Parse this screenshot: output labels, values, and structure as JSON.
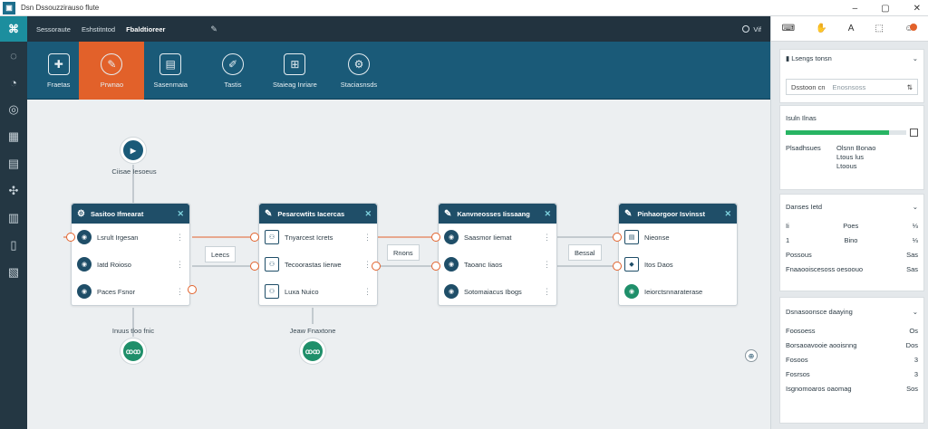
{
  "window": {
    "title": "Dsn Dssouzzirauso flute",
    "controls": [
      "–",
      "▢",
      "✕"
    ]
  },
  "rail": {
    "logo": "⌘",
    "icons": [
      "activity-icon",
      "timer-icon",
      "target-icon",
      "gallery-icon",
      "document-icon",
      "puzzle-icon",
      "building-icon",
      "book-icon",
      "notes-icon"
    ]
  },
  "topbar": {
    "nav": [
      "Sessoraute",
      "Eshstitntod",
      "Fbaldtioreer"
    ],
    "edit_icon": "✎",
    "user_label": "Vif"
  },
  "ribbon": {
    "items": [
      {
        "label": "Fraetas",
        "icon": "✚",
        "active": false
      },
      {
        "label": "Prwnao",
        "icon": "✎",
        "active": true
      },
      {
        "label": "Sasenmaia",
        "icon": "▤",
        "active": false
      },
      {
        "label": "Tastis",
        "icon": "✐",
        "active": false
      },
      {
        "label": "Staieag Inriare",
        "icon": "⊞",
        "active": false
      },
      {
        "label": "Staciasnsds",
        "icon": "⚙",
        "active": false
      }
    ]
  },
  "rp_top": {
    "icons": [
      "⌨",
      "✋",
      "A",
      "⬚",
      "☺"
    ]
  },
  "flow": {
    "start": {
      "caption": "Ciisae Iesoeus",
      "glyph": "▶"
    },
    "ends": [
      {
        "caption": "Inuus tloo fnic",
        "glyph": "ꝏꝏ"
      },
      {
        "caption": "Jeaw Fnaxtone",
        "glyph": "ꝏꝏ"
      }
    ],
    "cards": [
      {
        "title": "Sasitoo Ifmearat",
        "icon": "⚙",
        "rows": [
          {
            "label": "Lsrult Irgesan",
            "icon": "◉"
          },
          {
            "label": "Iatd Roioso",
            "icon": "◉"
          },
          {
            "label": "Paces Fsnor",
            "icon": "◉"
          }
        ]
      },
      {
        "title": "Pesarcwtits Iacercas",
        "icon": "✎",
        "rows": [
          {
            "label": "Tnyarcest Icrets",
            "icon": "⚇"
          },
          {
            "label": "Tecoorastas Iierwe",
            "icon": "⚇"
          },
          {
            "label": "Luxa Nuico",
            "icon": "⚇"
          }
        ]
      },
      {
        "title": "Kanvneosses Iissaang",
        "icon": "✎",
        "rows": [
          {
            "label": "Saasmor Iiemat",
            "icon": "◉"
          },
          {
            "label": "Taoanc Iiaos",
            "icon": "◉"
          },
          {
            "label": "Sotomaiacus Ibogs",
            "icon": "◉"
          }
        ]
      },
      {
        "title": "Pinhaorgoor Isvinsst",
        "icon": "✎",
        "rows": [
          {
            "label": "Nieonse",
            "icon": "▤"
          },
          {
            "label": "Itos Daos",
            "icon": "◆"
          },
          {
            "label": "Ieiorctsnnaraterase",
            "icon": "◉"
          }
        ]
      }
    ],
    "mid_labels": [
      "Leecs",
      "Rnons",
      "Bessal"
    ],
    "zoom_glyph": "⊕"
  },
  "panel": {
    "layers": {
      "title": "Lsengs tonsn",
      "chev": "⌄"
    },
    "search": {
      "prefix": "Dsstoon cn",
      "placeholder": "Enosnsoss",
      "icon": "⇅"
    },
    "progress": {
      "label": "Isuln Ilnas",
      "value": 0.86
    },
    "status": {
      "key": "Plsadhsues",
      "line1": "Olsnn Bonao",
      "line2": "Ltous lus",
      "line3": "Ltoous"
    },
    "props": {
      "title": "Danses Ietd",
      "chev": "⌄",
      "rows": [
        {
          "k": "Ii",
          "v": "Poes",
          "x": "⅓"
        },
        {
          "k": "1",
          "v": "Bino",
          "x": "⅓"
        },
        {
          "k": "Possous",
          "v": "",
          "x": "Sas"
        },
        {
          "k": "Fnaaooiscesoss oesoouo",
          "v": "",
          "x": "Sas"
        }
      ]
    },
    "settings": {
      "title": "Dsnasoonsce daaying",
      "chev": "⌄",
      "rows": [
        {
          "k": "Foosoess",
          "x": "Os"
        },
        {
          "k": "Borsaoavooie aooisnng",
          "x": "Dos"
        },
        {
          "k": "Fosoos",
          "x": "3"
        },
        {
          "k": "Fosrsos",
          "x": "3"
        },
        {
          "k": "Isgnomoaros oaomag",
          "x": "Sos"
        }
      ]
    }
  }
}
